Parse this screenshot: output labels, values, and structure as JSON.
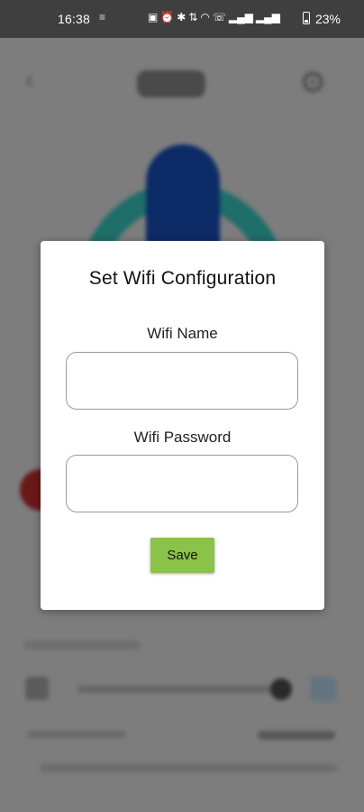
{
  "status_bar": {
    "time": "16:38",
    "battery_percent": "23%",
    "icons": [
      "notification-icon",
      "nfc-icon",
      "alarm-icon",
      "bluetooth-icon",
      "data-speed-icon",
      "wifi-icon",
      "call-icon",
      "signal-icon",
      "signal-icon",
      "battery-icon"
    ]
  },
  "dialog": {
    "title": "Set Wifi Configuration",
    "wifi_name_label": "Wifi Name",
    "wifi_name_value": "",
    "wifi_password_label": "Wifi Password",
    "wifi_password_value": "",
    "save_label": "Save",
    "save_color": "#8bc34a"
  },
  "background": {
    "accent_teal": "#1f6e6a",
    "accent_blue": "#0c2b66"
  }
}
